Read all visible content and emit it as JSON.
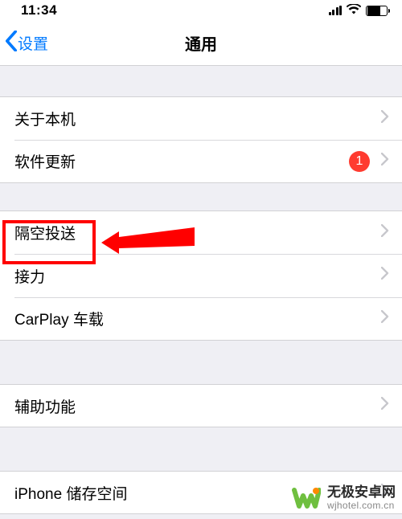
{
  "status": {
    "time": "11:34"
  },
  "nav": {
    "back_label": "设置",
    "title": "通用"
  },
  "group1": {
    "about": "关于本机",
    "software_update": "软件更新",
    "badge_count": "1"
  },
  "group2": {
    "airdrop": "隔空投送",
    "handoff": "接力",
    "carplay": "CarPlay 车载"
  },
  "group3": {
    "accessibility": "辅助功能"
  },
  "group4": {
    "storage": "iPhone 储存空间"
  },
  "watermark": {
    "line1": "无极安卓网",
    "line2": "wjhotel.com.cn"
  }
}
